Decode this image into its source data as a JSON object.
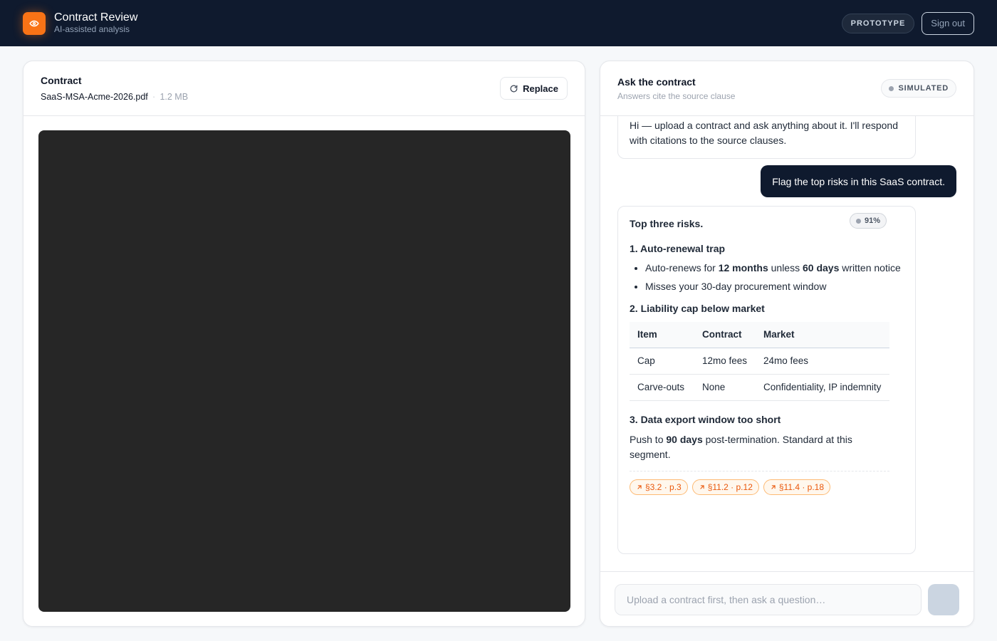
{
  "header": {
    "title": "Contract Review",
    "subtitle": "AI-assisted analysis",
    "badge": "PROTOTYPE",
    "signout_label": "Sign out",
    "logo_icon": "eye-icon",
    "accent": "#f97316"
  },
  "contract_panel": {
    "title": "Contract",
    "file_name": "SaaS-MSA-Acme-2026.pdf",
    "separator": "·",
    "file_size": "1.2 MB",
    "replace_label": "Replace",
    "replace_icon": "refresh-icon"
  },
  "chat_panel": {
    "title": "Ask the contract",
    "subtitle": "Answers cite the source clause",
    "badge": "SIMULATED"
  },
  "messages": {
    "intro": "Hi — upload a contract and ask anything about it. I'll respond with citations to the source clauses.",
    "user": "Flag the top risks in this SaaS contract.",
    "answer": {
      "confidence": "91%",
      "title": "Top three risks.",
      "risk1": {
        "heading": "1. Auto-renewal trap",
        "b1_pre": "Auto-renews for ",
        "b1_bold1": "12 months",
        "b1_mid": " unless ",
        "b1_bold2": "60 days",
        "b1_post": " written notice",
        "b2": "Misses your 30-day procurement window"
      },
      "risk2": {
        "heading": "2. Liability cap below market",
        "table": {
          "headers": [
            "Item",
            "Contract",
            "Market"
          ],
          "rows": [
            [
              "Cap",
              "12mo fees",
              "24mo fees"
            ],
            [
              "Carve-outs",
              "None",
              "Confidentiality, IP indemnity"
            ]
          ]
        }
      },
      "risk3": {
        "heading": "3. Data export window too short",
        "pre": "Push to ",
        "bold": "90 days",
        "post": " post-termination. Standard at this segment."
      },
      "citations": [
        "§3.2 · p.3",
        "§11.2 · p.12",
        "§11.4 · p.18"
      ],
      "citation_icon": "arrow-up-right-icon"
    }
  },
  "composer": {
    "placeholder": "Upload a contract first, then ask a question…"
  }
}
